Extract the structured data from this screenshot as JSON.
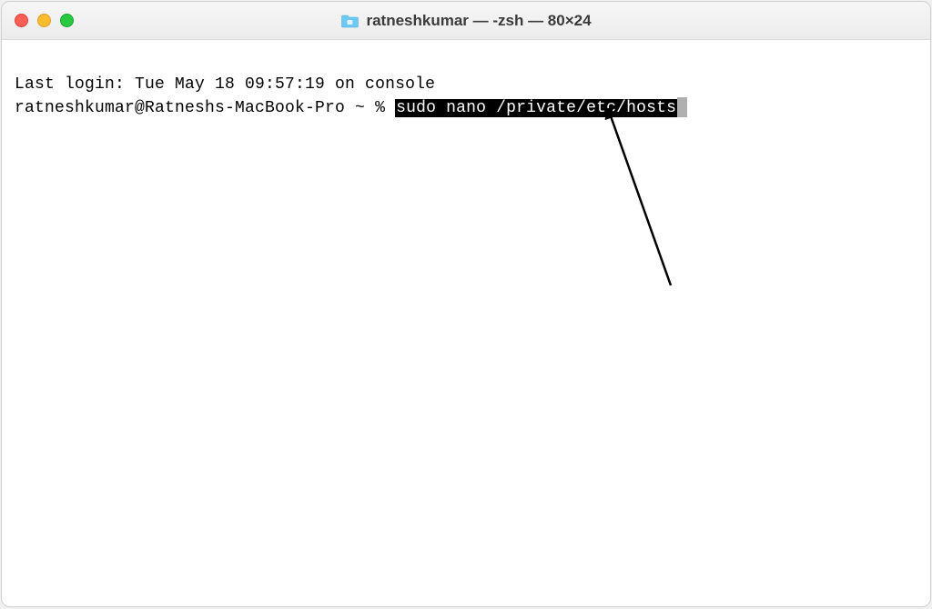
{
  "title_bar": {
    "title": "ratneshkumar — -zsh — 80×24"
  },
  "terminal": {
    "last_login_line": "Last login: Tue May 18 09:57:19 on console",
    "prompt": "ratneshkumar@Ratneshs-MacBook-Pro ~ % ",
    "command": "sudo nano /private/etc/hosts"
  }
}
